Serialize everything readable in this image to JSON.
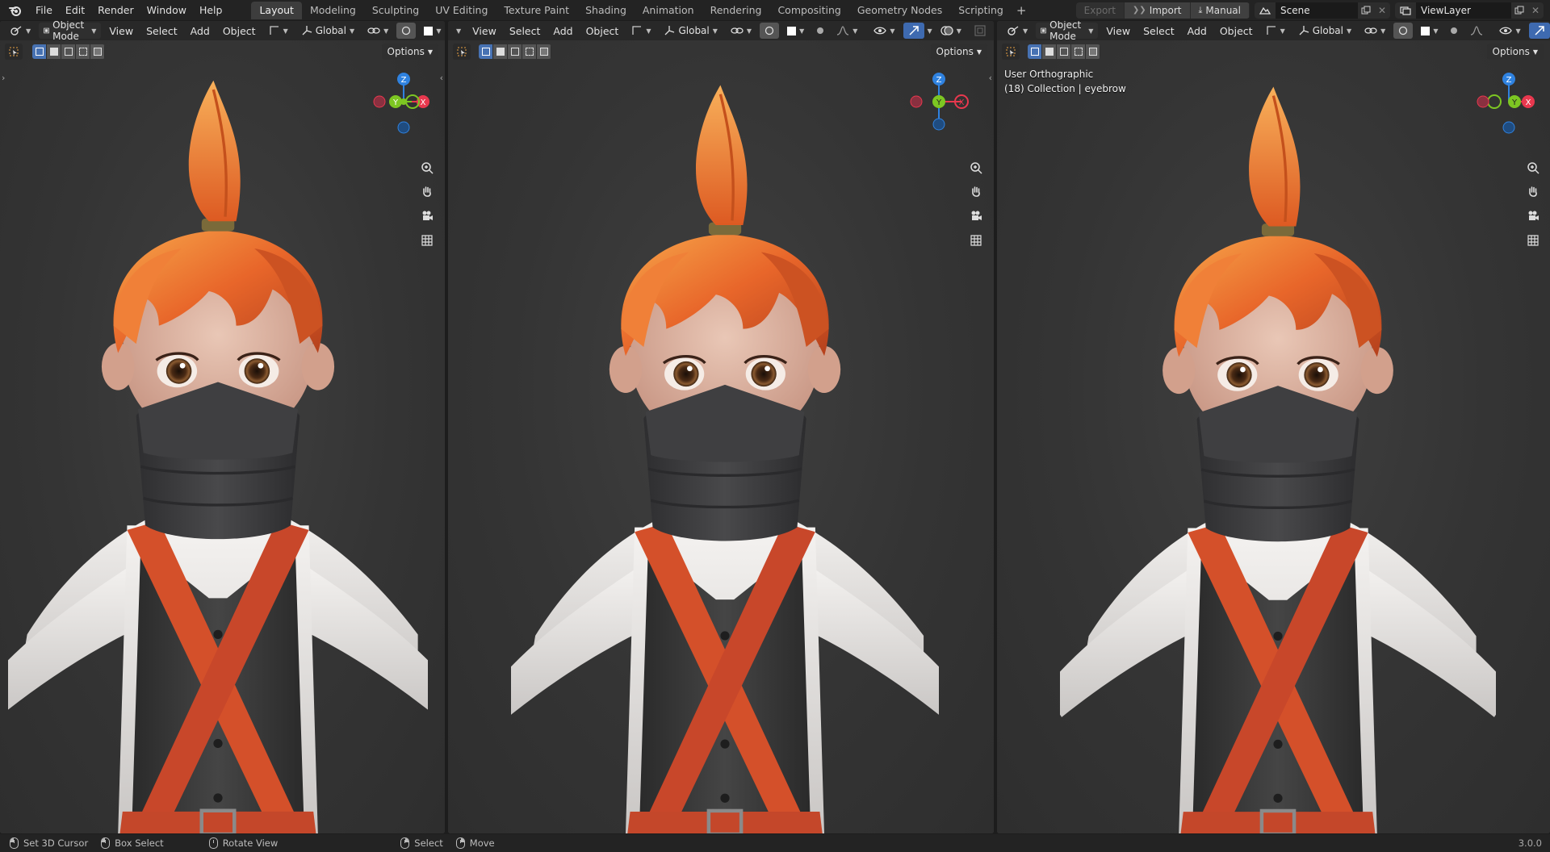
{
  "menubar": {
    "items": [
      "File",
      "Edit",
      "Render",
      "Window",
      "Help"
    ]
  },
  "workspaces": {
    "tabs": [
      "Layout",
      "Modeling",
      "Sculpting",
      "UV Editing",
      "Texture Paint",
      "Shading",
      "Animation",
      "Rendering",
      "Compositing",
      "Geometry Nodes",
      "Scripting"
    ],
    "active": "Layout",
    "add_symbol": "+"
  },
  "topright": {
    "export_label": "Export",
    "import_label": "Import",
    "manual_label": "Manual",
    "scene_name": "Scene",
    "view_layer_name": "ViewLayer"
  },
  "viewport1": {
    "mode": "Object Mode",
    "menus": [
      "View",
      "Select",
      "Add",
      "Object"
    ],
    "orientation": "Global",
    "options_label": "Options"
  },
  "viewport2": {
    "menus": [
      "View",
      "Select",
      "Add",
      "Object"
    ],
    "orientation": "Global",
    "options_label": "Options"
  },
  "viewport3": {
    "mode": "Object Mode",
    "menus": [
      "View",
      "Select",
      "Add",
      "Object"
    ],
    "orientation": "Global",
    "options_label": "Options",
    "view_name": "User Orthographic",
    "collection_info": "(18) Collection | eyebrow"
  },
  "gizmo_axes": {
    "z": "Z",
    "y": "Y",
    "x": "X"
  },
  "statusbar": {
    "set_cursor": "Set 3D Cursor",
    "box_select": "Box Select",
    "rotate_view": "Rotate View",
    "select": "Select",
    "move": "Move",
    "version": "3.0.0"
  },
  "colors": {
    "accent_blue": "#4772b3",
    "axis_x": "#e8384e",
    "axis_y": "#7dc622",
    "axis_z": "#2f82e0",
    "hair": "#e8662a",
    "scarf": "#3c3c3e",
    "strap": "#d4502a",
    "shirt": "#e6e4e2"
  }
}
